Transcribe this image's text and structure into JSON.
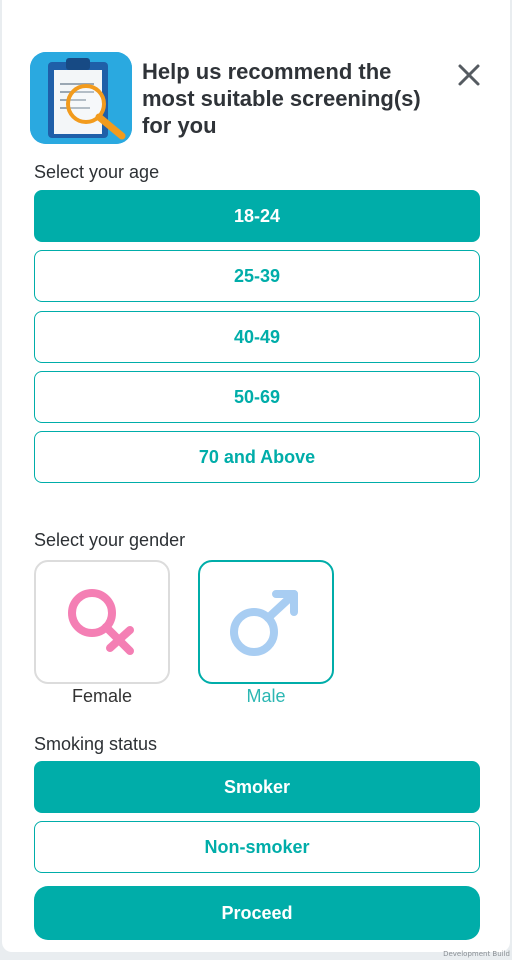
{
  "header": {
    "title": "Help us recommend the most suitable screening(s) for you",
    "icon": "clipboard-magnifier-icon",
    "close_icon": "close-icon"
  },
  "age": {
    "label": "Select your age",
    "options": [
      "18-24",
      "25-39",
      "40-49",
      "50-69",
      "70 and Above"
    ],
    "selected": "18-24"
  },
  "gender": {
    "label": "Select your gender",
    "options": [
      {
        "label": "Female",
        "icon": "female-symbol-icon"
      },
      {
        "label": "Male",
        "icon": "male-symbol-icon"
      }
    ],
    "selected": "Male"
  },
  "smoking": {
    "label": "Smoking status",
    "options": [
      "Smoker",
      "Non-smoker"
    ],
    "selected": "Smoker"
  },
  "proceed_label": "Proceed",
  "env_badge": "Development Build",
  "colors": {
    "accent": "#00ada9",
    "female": "#f47fb4",
    "male": "#a8cdf2",
    "unselected_border": "#dcdcdc"
  }
}
